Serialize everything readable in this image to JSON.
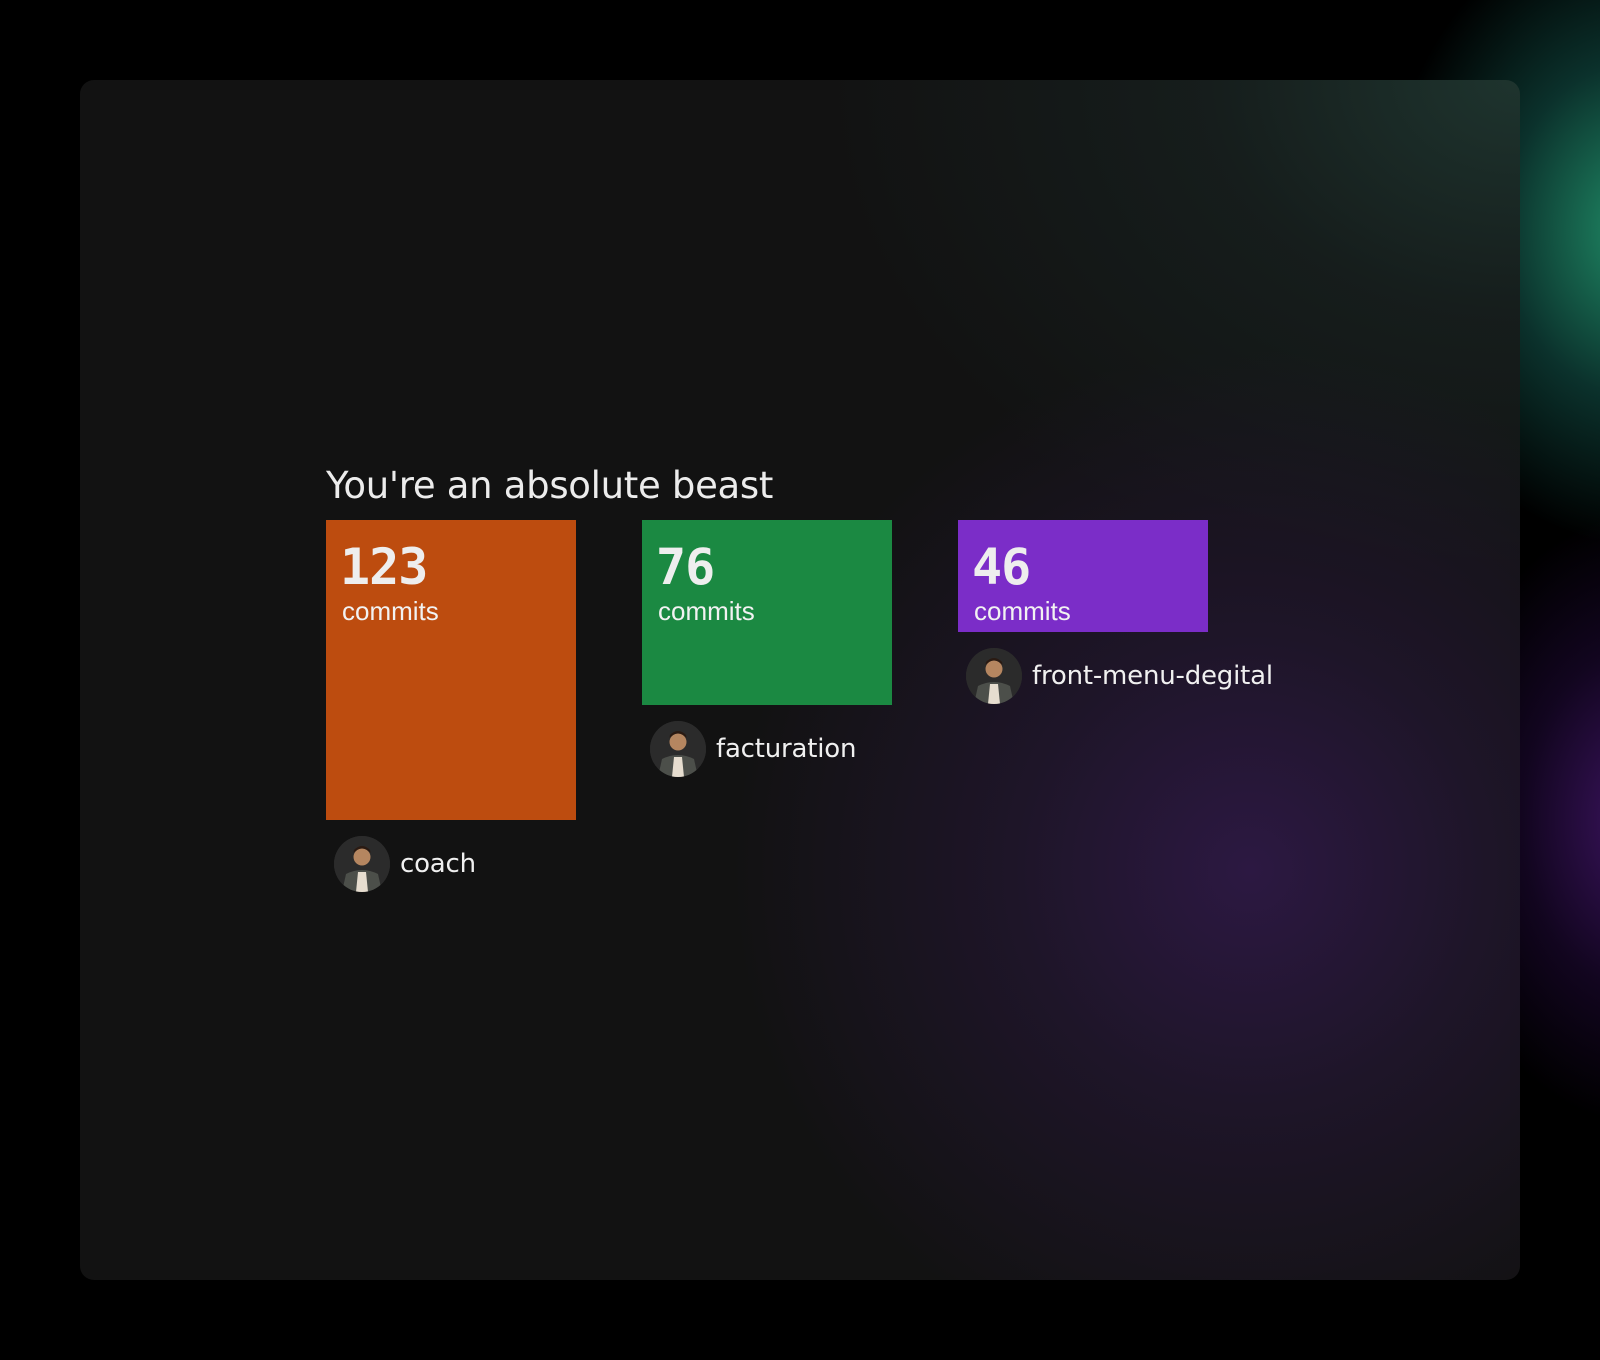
{
  "heading": "You're an absolute beast",
  "unit_label": "commits",
  "repos": [
    {
      "name": "coach",
      "commits": "123",
      "color": "#bd4c0f"
    },
    {
      "name": "facturation",
      "commits": "76",
      "color": "#1b8942"
    },
    {
      "name": "front-menu-degital",
      "commits": "46",
      "color": "#7b2dc8"
    }
  ],
  "theme": {
    "card_background": "#121212",
    "text_color": "#ececec",
    "glow_top_right": "#22966e",
    "glow_right": "#4b1978"
  },
  "chart_data": {
    "type": "bar",
    "categories": [
      "coach",
      "facturation",
      "front-menu-degital"
    ],
    "values": [
      123,
      76,
      46
    ],
    "title": "You're an absolute beast",
    "xlabel": "",
    "ylabel": "",
    "unit": "commits",
    "grid": false
  }
}
